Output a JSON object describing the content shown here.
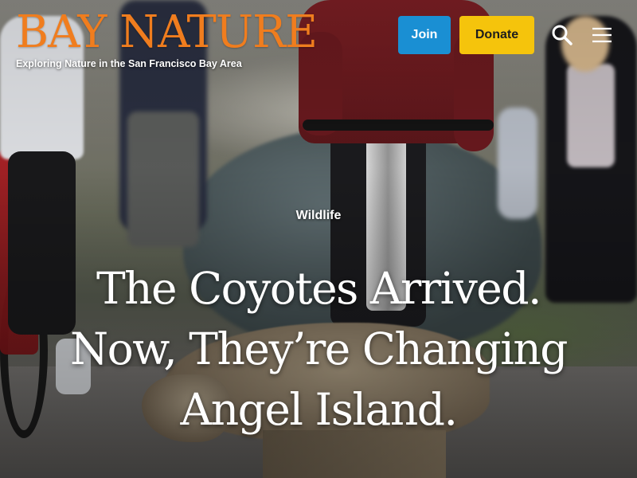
{
  "header": {
    "logo_title": "BAY NATURE",
    "logo_tagline": "Exploring Nature in the San Francisco Bay Area",
    "join_label": "Join",
    "donate_label": "Donate",
    "search_icon": "search-icon",
    "menu_icon": "hamburger-menu-icon"
  },
  "hero": {
    "category": "Wildlife",
    "headline": "The Coyotes Arrived. Now, They’re Changing Angel Island."
  },
  "colors": {
    "logo": "#f07d1e",
    "join_button": "#1a8fd3",
    "donate_button": "#f5c40c",
    "text": "#ffffff"
  }
}
